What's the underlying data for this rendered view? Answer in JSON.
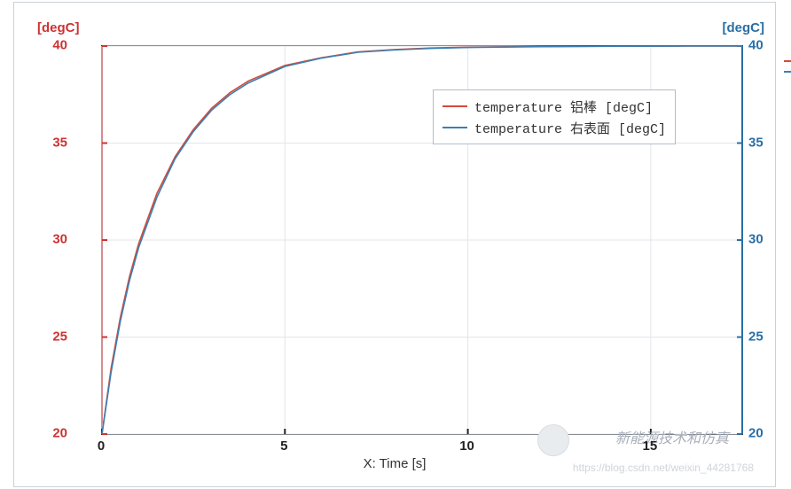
{
  "chart_data": {
    "type": "line",
    "xlabel": "X: Time [s]",
    "ylabel_left": "[degC]",
    "ylabel_right": "[degC]",
    "xlim": [
      0,
      17.5
    ],
    "ylim": [
      20,
      40
    ],
    "x_ticks": [
      0,
      5,
      10,
      15
    ],
    "y_ticks_left": [
      20,
      25,
      30,
      35,
      40
    ],
    "y_ticks_right": [
      20,
      25,
      30,
      35,
      40
    ],
    "x": [
      0,
      0.25,
      0.5,
      0.75,
      1,
      1.5,
      2,
      2.5,
      3,
      3.5,
      4,
      5,
      6,
      7,
      8,
      9,
      10,
      12,
      14,
      16,
      17.5
    ],
    "series": [
      {
        "name": "temperature 铝棒 [degC]",
        "color": "#d44a3a",
        "values": [
          20.0,
          23.4,
          26.0,
          28.1,
          29.8,
          32.4,
          34.3,
          35.7,
          36.8,
          37.6,
          38.2,
          39.0,
          39.4,
          39.7,
          39.82,
          39.9,
          39.94,
          39.98,
          39.99,
          40.0,
          40.0
        ]
      },
      {
        "name": "temperature 右表面 [degC]",
        "color": "#3d7fb0",
        "values": [
          20.0,
          23.2,
          25.8,
          27.9,
          29.6,
          32.2,
          34.2,
          35.6,
          36.7,
          37.5,
          38.1,
          38.95,
          39.38,
          39.68,
          39.8,
          39.88,
          39.93,
          39.97,
          39.99,
          40.0,
          40.0
        ]
      }
    ]
  },
  "legend": {
    "entries": [
      {
        "label": "temperature 铝棒 [degC]",
        "color": "#d44a3a"
      },
      {
        "label": "temperature 右表面 [degC]",
        "color": "#3d7fb0"
      }
    ]
  },
  "watermark": {
    "brand": "新能源技术和仿真",
    "url": "https://blog.csdn.net/weixin_44281768"
  }
}
